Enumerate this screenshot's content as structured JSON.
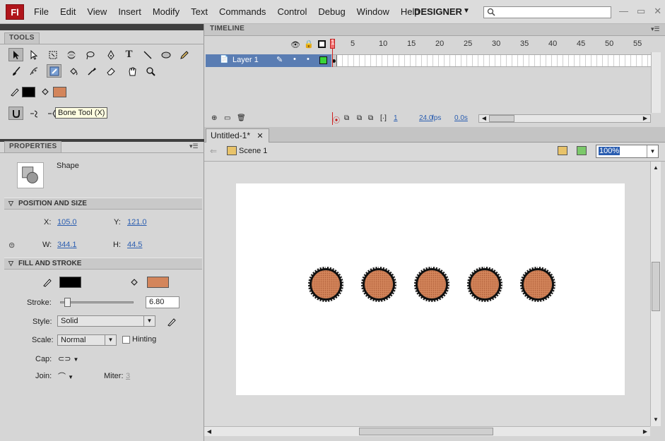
{
  "app": {
    "logo": "Fl"
  },
  "menubar": {
    "items": [
      "File",
      "Edit",
      "View",
      "Insert",
      "Modify",
      "Text",
      "Commands",
      "Control",
      "Debug",
      "Window",
      "Help"
    ],
    "workspace": "DESIGNER",
    "search_placeholder": ""
  },
  "tools_panel": {
    "tab": "TOOLS",
    "tooltip": "Bone Tool (X)"
  },
  "properties": {
    "tab": "PROPERTIES",
    "object_type": "Shape",
    "position_size": {
      "header": "POSITION AND SIZE",
      "x_label": "X:",
      "x": "105.0",
      "y_label": "Y:",
      "y": "121.0",
      "w_label": "W:",
      "w": "344.1",
      "h_label": "H:",
      "h": "44.5"
    },
    "fill_stroke": {
      "header": "FILL AND STROKE",
      "stroke_color": "#000000",
      "fill_color": "#d3855b",
      "stroke_label": "Stroke:",
      "stroke_value": "6.80",
      "stroke_slider_level": 0.05,
      "style_label": "Style:",
      "style_value": "Solid",
      "scale_label": "Scale:",
      "scale_value": "Normal",
      "hinting_label": "Hinting",
      "cap_label": "Cap:",
      "join_label": "Join:",
      "miter_label": "Miter:",
      "miter_value": "3"
    }
  },
  "timeline": {
    "tab": "TIMELINE",
    "layer_name": "Layer 1",
    "frame_numbers": [
      "1",
      "5",
      "10",
      "15",
      "20",
      "25",
      "30",
      "35",
      "40",
      "45",
      "50",
      "55"
    ],
    "current_frame": "1",
    "fps": "24.0",
    "fps_unit": "fps",
    "time": "0.0s"
  },
  "document": {
    "tab_title": "Untitled-1*",
    "scene": "Scene 1",
    "zoom": "100%"
  }
}
